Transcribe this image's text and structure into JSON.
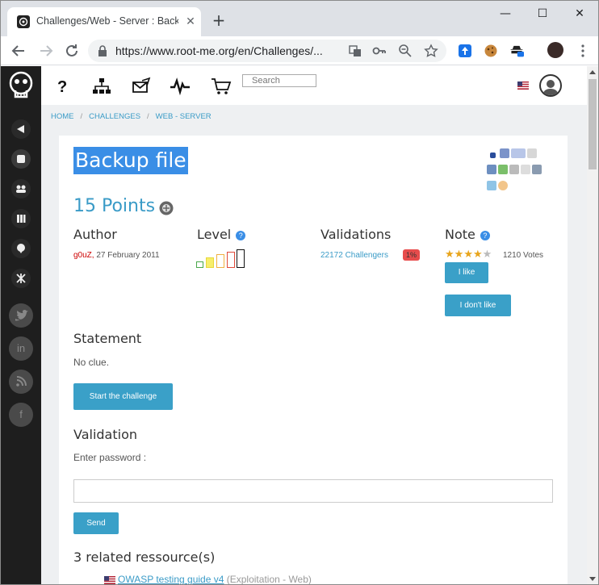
{
  "browser": {
    "tab_title": "Challenges/Web - Server : Backup",
    "tab_close": "✕",
    "new_tab": "+",
    "win_min": "—",
    "win_max": "☐",
    "win_close": "✕",
    "url": "https://www.root-me.org/en/Challenges/..."
  },
  "site": {
    "search_placeholder": "Search"
  },
  "breadcrumb": [
    "HOME",
    "CHALLENGES",
    "WEB - SERVER"
  ],
  "breadcrumb_sep": "/",
  "challenge": {
    "title": "Backup file",
    "points": "15 Points",
    "author_header": "Author",
    "author_name": "g0uZ,",
    "author_date": "27 February 2011",
    "level_header": "Level",
    "help": "?",
    "validations_header": "Validations",
    "validations_link": "22172 Challengers",
    "validations_pct": "1%",
    "note_header": "Note",
    "rating_stars": 4,
    "rating_max": 5,
    "votes": "1210 Votes",
    "like_button": "I like",
    "dislike_button": "I don't like",
    "statement_header": "Statement",
    "statement_text": "No clue.",
    "start_button": "Start the challenge",
    "validation_header": "Validation",
    "password_label": "Enter password :",
    "send_button": "Send",
    "resources_header": "3 related ressource(s)",
    "resource_link": "OWASP testing guide v4",
    "resource_category": "(Exploitation - Web)"
  },
  "colors": {
    "accent": "#3a9bc7",
    "button": "#3aa0c8",
    "title_highlight": "#3a8ee6",
    "sidebar": "#1e1e1e",
    "author": "#cc0000",
    "badge": "#e74c4c"
  }
}
